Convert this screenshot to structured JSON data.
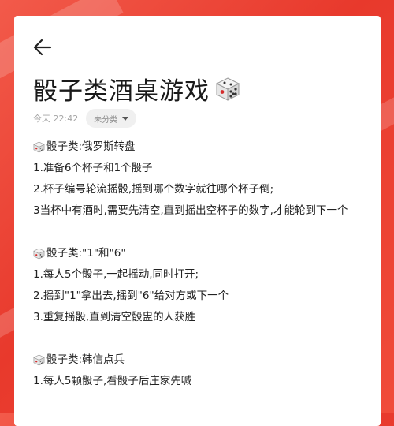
{
  "header": {
    "back_label": "←"
  },
  "note": {
    "title": "骰子类酒桌游戏",
    "time": "今天 22:42",
    "category": "未分类"
  },
  "body": {
    "section1": {
      "heading": "骰子类:俄罗斯转盘",
      "line1": "1.准备6个杯子和1个骰子",
      "line2": "2.杯子编号轮流摇骰,摇到哪个数字就往哪个杯子倒;",
      "line3": "3当杯中有酒时,需要先清空,直到摇出空杯子的数字,才能轮到下一个"
    },
    "section2": {
      "heading": "骰子类:\"1\"和\"6\"",
      "line1": "1.每人5个骰子,一起摇动,同时打开;",
      "line2": "2.摇到\"1\"拿出去,摇到\"6\"给对方或下一个",
      "line3": "3.重复摇骰,直到清空骰盅的人获胜"
    },
    "section3": {
      "heading": "骰子类:韩信点兵",
      "line1": "1.每人5颗骰子,看骰子后庄家先喊"
    }
  },
  "colors": {
    "background": "#e8392c",
    "card": "#ffffff"
  }
}
